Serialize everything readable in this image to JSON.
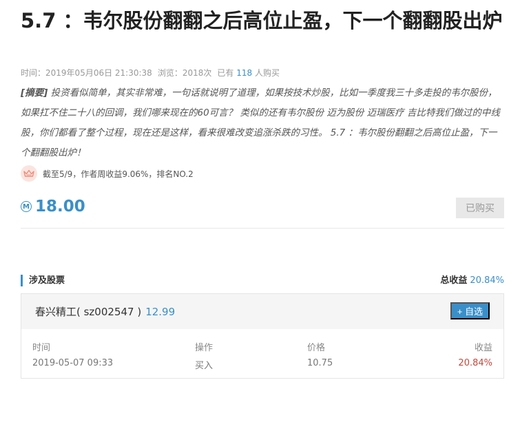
{
  "article": {
    "title": "5.7 ：韦尔股份翻翻之后高位止盈，下一个翻翻股出炉",
    "meta": {
      "time_label": "时间：",
      "time_value": "2019年05月06日 21:30:38",
      "views_label": "浏览：",
      "views_value": "2018次",
      "buyers_prefix": "已有",
      "buyers_count": "118",
      "buyers_suffix": "人购买"
    },
    "abstract": {
      "tag": "[摘要]",
      "text": " 投资看似简单，其实非常难，一句话就说明了道理，如果按技术炒股，比如一季度我三十多走投的韦尔股份，如果扛不住二十八的回调，我们哪来现在的60可言？ 类似的还有韦尔股份 迈为股份 迈瑞医疗 吉比特我们做过的中线股，你们都看了整个过程，现在还是这样，看来很难改变追涨杀跌的习性。 5.7 ：韦尔股份翻翻之后高位止盈，下一个翻翻股出炉！"
    },
    "rank_text": "截至5/9，作者周收益9.06%，排名NO.2",
    "price": "18.00",
    "coin_symbol": "M",
    "bought_label": "已购买"
  },
  "stocks_section": {
    "title": "涉及股票",
    "total_label": "总收益",
    "total_value": "20.84%",
    "stock": {
      "name": "春兴精工( sz002547 )",
      "price": "12.99",
      "watch_label": "+ 自选"
    },
    "columns": [
      "时间",
      "操作",
      "价格",
      "收益"
    ],
    "trade": {
      "time": "2019-05-07 09:33",
      "action": "买入",
      "price": "10.75",
      "gain": "20.84%"
    }
  },
  "colors": {
    "accent": "#3a8fc9",
    "gain": "#c04a3d",
    "crown_bg": "#fbe4df",
    "crown": "#e8907f"
  },
  "icons": {
    "crown": "crown-icon",
    "coin": "coin-icon"
  }
}
